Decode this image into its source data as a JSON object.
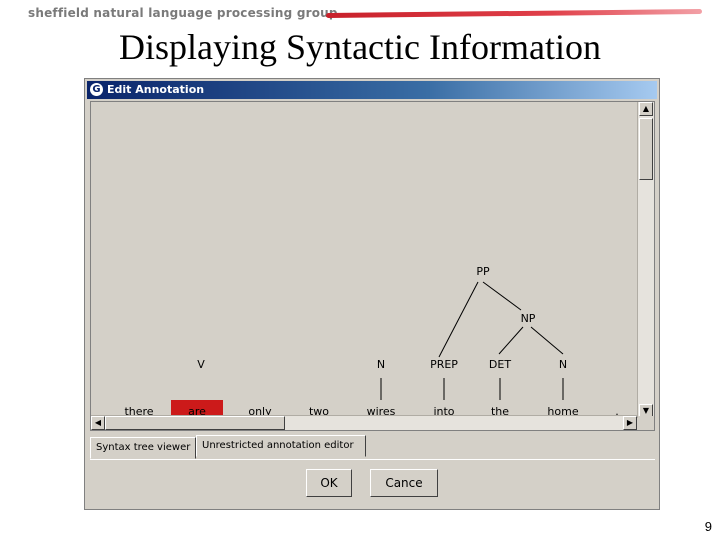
{
  "header": {
    "brand": "sheffield natural language processing group",
    "accent_color": "#c8202a"
  },
  "slide": {
    "title": "Displaying Syntactic Information",
    "page_number": "9"
  },
  "window": {
    "title": "Edit Annotation",
    "tabs": [
      "Syntax tree viewer",
      "Unrestricted annotation editor"
    ],
    "buttons": {
      "ok": "OK",
      "cancel": "Cance"
    }
  },
  "tree": {
    "words": [
      "there",
      "are",
      "only",
      "two",
      "wires",
      "into",
      "the",
      "home",
      "."
    ],
    "selected_word": "are",
    "selected_color": "#cc1a1a",
    "pos_tags": [
      "V",
      "N",
      "PREP",
      "DET",
      "N"
    ],
    "phrases": [
      "PP",
      "NP"
    ]
  }
}
